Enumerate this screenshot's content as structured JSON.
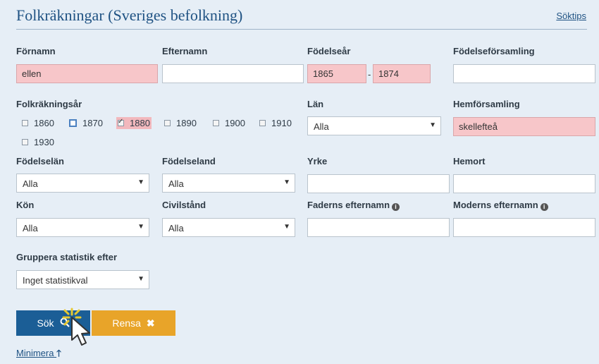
{
  "header": {
    "title": "Folkräkningar (Sveriges befolkning)",
    "tips_link": "Söktips"
  },
  "fields": {
    "fornamn": {
      "label": "Förnamn",
      "value": "ellen"
    },
    "efternamn": {
      "label": "Efternamn",
      "value": ""
    },
    "fodelsear": {
      "label": "Födelseår",
      "from": "1865",
      "separator": "-",
      "to": "1874"
    },
    "fodelseforsamling": {
      "label": "Födelseförsamling",
      "value": ""
    },
    "folkrakningsar": {
      "label": "Folkräkningsår",
      "years": [
        {
          "label": "1860",
          "checked": false
        },
        {
          "label": "1870",
          "checked": false
        },
        {
          "label": "1880",
          "checked": true
        },
        {
          "label": "1890",
          "checked": false
        },
        {
          "label": "1900",
          "checked": false
        },
        {
          "label": "1910",
          "checked": false
        },
        {
          "label": "1930",
          "checked": false
        }
      ]
    },
    "lan": {
      "label": "Län",
      "value": "Alla"
    },
    "hemforsamling": {
      "label": "Hemförsamling",
      "value": "skellefteå"
    },
    "fodelselan": {
      "label": "Födelselän",
      "value": "Alla"
    },
    "fodelseland": {
      "label": "Födelseland",
      "value": "Alla"
    },
    "yrke": {
      "label": "Yrke",
      "value": ""
    },
    "hemort": {
      "label": "Hemort",
      "value": ""
    },
    "kon": {
      "label": "Kön",
      "value": "Alla"
    },
    "civilstand": {
      "label": "Civilstånd",
      "value": "Alla"
    },
    "faderns_efternamn": {
      "label": "Faderns efternamn",
      "value": ""
    },
    "moderns_efternamn": {
      "label": "Moderns efternamn",
      "value": ""
    },
    "gruppera": {
      "label": "Gruppera statistik efter",
      "value": "Inget statistikval"
    }
  },
  "buttons": {
    "search": "Sök",
    "clear": "Rensa",
    "minimize": "Minimera"
  },
  "colors": {
    "filled_bg": "#f7c6c9",
    "search_btn": "#1b5e96",
    "clear_btn": "#e8a429",
    "link": "#1f5283"
  }
}
